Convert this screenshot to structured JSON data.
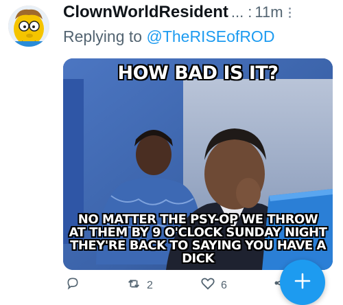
{
  "tweet": {
    "display_name": "ClownWorldResident",
    "name_truncation": "...",
    "separator": ":",
    "time": "11m",
    "reply_prefix": "Replying to",
    "reply_handle": "@TheRISEofROD"
  },
  "media": {
    "top_caption": "HOW BAD IS IT?",
    "bottom_caption_lines": [
      "NO MATTER THE PSY-OP WE THROW",
      "AT THEM BY 9 O'CLOCK SUNDAY NIGHT",
      "THEY'RE BACK TO SAYING YOU HAVE A DICK"
    ]
  },
  "actions": {
    "retweet_count": "2",
    "like_count": "6"
  },
  "icons": {
    "reply": "reply-icon",
    "retweet": "retweet-icon",
    "like": "heart-icon",
    "share": "share-icon",
    "compose": "plus-icon",
    "more": "more-icon"
  },
  "colors": {
    "accent": "#1d9bf0",
    "secondary_text": "#536471"
  }
}
